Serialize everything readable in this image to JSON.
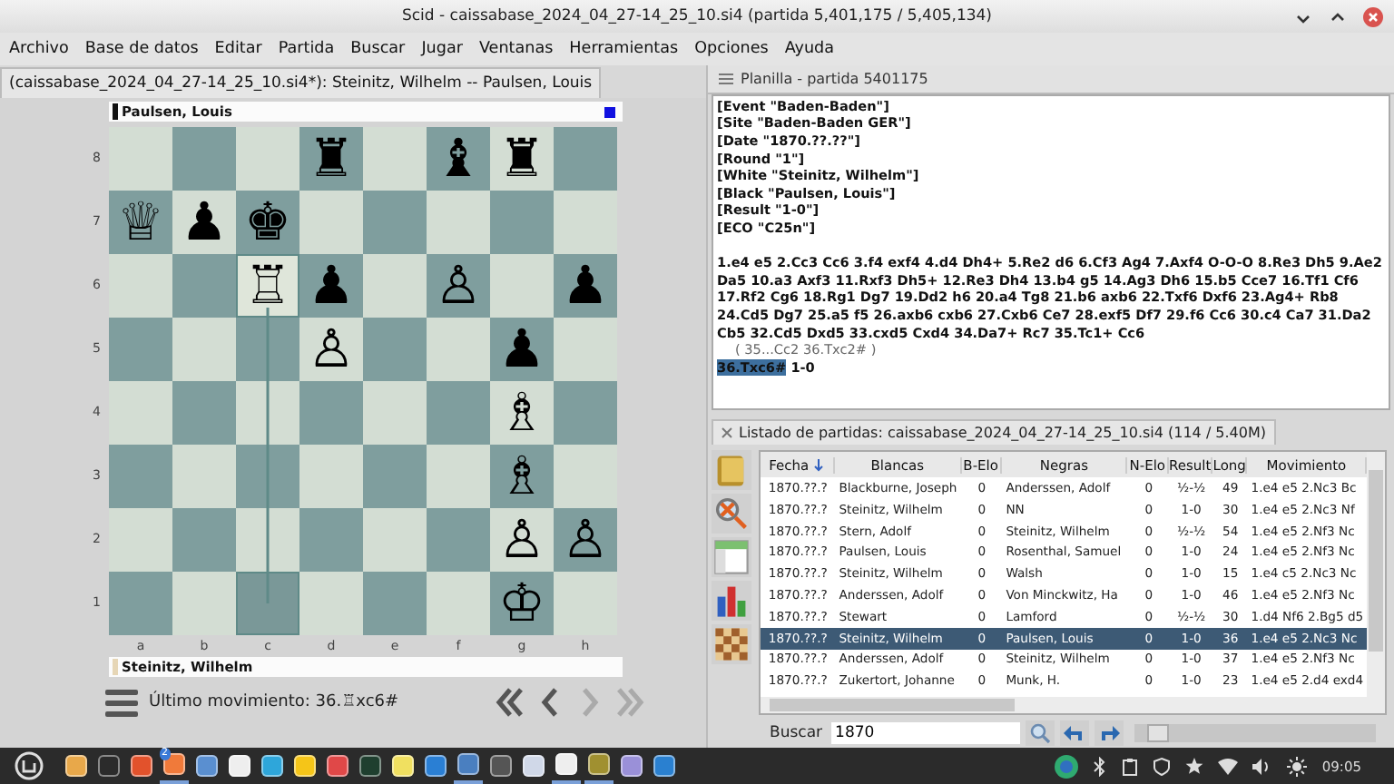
{
  "window": {
    "title": "Scid - caissabase_2024_04_27-14_25_10.si4 (partida 5,401,175 / 5,405,134)"
  },
  "menu": [
    "Archivo",
    "Base de datos",
    "Editar",
    "Partida",
    "Buscar",
    "Jugar",
    "Ventanas",
    "Herramientas",
    "Opciones",
    "Ayuda"
  ],
  "board_pane": {
    "tab": "(caissabase_2024_04_27-14_25_10.si4*): Steinitz, Wilhelm -- Paulsen, Louis",
    "top_player": "Paulsen, Louis",
    "bottom_player": "Steinitz, Wilhelm",
    "ranks": [
      "8",
      "7",
      "6",
      "5",
      "4",
      "3",
      "2",
      "1"
    ],
    "files": [
      "a",
      "b",
      "c",
      "d",
      "e",
      "f",
      "g",
      "h"
    ],
    "rows": [
      [
        {
          "highlighted": false
        },
        {
          "highlighted": false
        },
        {
          "highlighted": false
        },
        {
          "highlighted": false,
          "piece": "♜"
        },
        {
          "highlighted": false
        },
        {
          "highlighted": false,
          "piece": "♝"
        },
        {
          "highlighted": false,
          "piece": "♜"
        },
        {
          "highlighted": false
        }
      ],
      [
        {
          "highlighted": false,
          "piece": "♕"
        },
        {
          "highlighted": false,
          "piece": "♟"
        },
        {
          "highlighted": false,
          "piece": "♚"
        },
        {
          "highlighted": false
        },
        {
          "highlighted": false
        },
        {
          "highlighted": false
        },
        {
          "highlighted": false
        },
        {
          "highlighted": false
        }
      ],
      [
        {
          "highlighted": false
        },
        {
          "highlighted": false
        },
        {
          "highlighted": true,
          "piece": "♖"
        },
        {
          "highlighted": false,
          "piece": "♟"
        },
        {
          "highlighted": false
        },
        {
          "highlighted": false,
          "piece": "♙"
        },
        {
          "highlighted": false
        },
        {
          "highlighted": false,
          "piece": "♟"
        }
      ],
      [
        {
          "highlighted": false
        },
        {
          "highlighted": false
        },
        {
          "highlighted": false
        },
        {
          "highlighted": false,
          "piece": "♙"
        },
        {
          "highlighted": false
        },
        {
          "highlighted": false
        },
        {
          "highlighted": false,
          "piece": "♟"
        },
        {
          "highlighted": false
        }
      ],
      [
        {
          "highlighted": false
        },
        {
          "highlighted": false
        },
        {
          "highlighted": false
        },
        {
          "highlighted": false
        },
        {
          "highlighted": false
        },
        {
          "highlighted": false
        },
        {
          "highlighted": false,
          "piece": "♗"
        },
        {
          "highlighted": false
        }
      ],
      [
        {
          "highlighted": false
        },
        {
          "highlighted": false
        },
        {
          "highlighted": false
        },
        {
          "highlighted": false
        },
        {
          "highlighted": false
        },
        {
          "highlighted": false
        },
        {
          "highlighted": false,
          "piece": "♗"
        },
        {
          "highlighted": false
        }
      ],
      [
        {
          "highlighted": false
        },
        {
          "highlighted": false
        },
        {
          "highlighted": false
        },
        {
          "highlighted": false
        },
        {
          "highlighted": false
        },
        {
          "highlighted": false
        },
        {
          "highlighted": false,
          "piece": "♙"
        },
        {
          "highlighted": false,
          "piece": "♙"
        }
      ],
      [
        {
          "highlighted": false
        },
        {
          "highlighted": false
        },
        {
          "highlighted": true
        },
        {
          "highlighted": false
        },
        {
          "highlighted": false
        },
        {
          "highlighted": false
        },
        {
          "highlighted": false,
          "piece": "♔"
        },
        {
          "highlighted": false
        }
      ]
    ],
    "last_move": "Último movimiento: 36.♖xc6#",
    "nav": [
      {
        "kind": "first",
        "disabled": false
      },
      {
        "kind": "back",
        "disabled": false
      },
      {
        "kind": "forward",
        "disabled": true
      },
      {
        "kind": "last",
        "disabled": true
      }
    ]
  },
  "pgn": {
    "title": "Planilla - partida 5401175",
    "headers": [
      "[Event \"Baden-Baden\"]",
      "[Site \"Baden-Baden GER\"]",
      "[Date \"1870.??.??\"]",
      "[Round \"1\"]",
      "[White \"Steinitz, Wilhelm\"]",
      "[Black \"Paulsen, Louis\"]",
      "[Result \"1-0\"]",
      "[ECO \"C25n\"]"
    ],
    "moves": "1.e4 e5 2.Cc3 Cc6 3.f4 exf4 4.d4 Dh4+ 5.Re2 d6 6.Cf3 Ag4 7.Axf4 O-O-O 8.Re3 Dh5 9.Ae2 Da5 10.a3 Axf3 11.Rxf3 Dh5+ 12.Re3 Dh4 13.b4 g5 14.Ag3 Dh6 15.b5 Cce7 16.Tf1 Cf6 17.Rf2 Cg6 18.Rg1 Dg7 19.Dd2 h6 20.a4 Tg8 21.b6 axb6 22.Txf6 Dxf6 23.Ag4+ Rb8 24.Cd5 Dg7 25.a5 f5 26.axb6 cxb6 27.Cxb6 Ce7 28.exf5 Df7 29.f6 Cc6 30.c4 Ca7 31.Da2 Cb5 32.Cd5 Dxd5 33.cxd5 Cxd4 34.Da7+ Rc7 35.Tc1+ Cc6",
    "variation": "( 35...Cc2 36.Txc2# )",
    "current_move": "36.Txc6#",
    "result": "1-0"
  },
  "game_list": {
    "title": "Listado de partidas: caissabase_2024_04_27-14_25_10.si4 (114 / 5.40M)",
    "columns": [
      "Fecha",
      "Blancas",
      "B-Elo",
      "Negras",
      "N-Elo",
      "Result",
      "Long",
      "Movimiento"
    ],
    "rows": [
      {
        "cells": [
          "1870.??.?",
          "Blackburne, Joseph",
          "0",
          "Anderssen, Adolf",
          "0",
          "½-½",
          "49",
          "1.e4 e5 2.Nc3 Bc"
        ],
        "selected": false
      },
      {
        "cells": [
          "1870.??.?",
          "Steinitz, Wilhelm",
          "0",
          "NN",
          "0",
          "1-0",
          "30",
          "1.e4 e5 2.Nc3 Nf"
        ],
        "selected": false
      },
      {
        "cells": [
          "1870.??.?",
          "Stern, Adolf",
          "0",
          "Steinitz, Wilhelm",
          "0",
          "½-½",
          "54",
          "1.e4 e5 2.Nf3 Nc"
        ],
        "selected": false
      },
      {
        "cells": [
          "1870.??.?",
          "Paulsen, Louis",
          "0",
          "Rosenthal, Samuel",
          "0",
          "1-0",
          "24",
          "1.e4 e5 2.Nf3 Nc"
        ],
        "selected": false
      },
      {
        "cells": [
          "1870.??.?",
          "Steinitz, Wilhelm",
          "0",
          "Walsh",
          "0",
          "1-0",
          "15",
          "1.e4 c5 2.Nc3 Nc"
        ],
        "selected": false
      },
      {
        "cells": [
          "1870.??.?",
          "Anderssen, Adolf",
          "0",
          "Von Minckwitz, Ha",
          "0",
          "1-0",
          "46",
          "1.e4 e5 2.Nf3 Nc"
        ],
        "selected": false
      },
      {
        "cells": [
          "1870.??.?",
          "Stewart",
          "0",
          "Lamford",
          "0",
          "½-½",
          "30",
          "1.d4 Nf6 2.Bg5 d5"
        ],
        "selected": false
      },
      {
        "cells": [
          "1870.??.?",
          "Steinitz, Wilhelm",
          "0",
          "Paulsen, Louis",
          "0",
          "1-0",
          "36",
          "1.e4 e5 2.Nc3 Nc"
        ],
        "selected": true
      },
      {
        "cells": [
          "1870.??.?",
          "Anderssen, Adolf",
          "0",
          "Steinitz, Wilhelm",
          "0",
          "1-0",
          "37",
          "1.e4 e5 2.Nf3 Nc"
        ],
        "selected": false
      },
      {
        "cells": [
          "1870.??.?",
          "Zukertort, Johanne",
          "0",
          "Munk, H.",
          "0",
          "1-0",
          "23",
          "1.e4 e5 2.d4 exd4"
        ],
        "selected": false
      }
    ],
    "search_label": "Buscar",
    "search_value": "1870",
    "slider": {
      "level": 0.05
    }
  },
  "taskbar": {
    "apps": [
      {
        "color": "#e8a84a",
        "active": false
      },
      {
        "color": "#2b2b2b",
        "active": false
      },
      {
        "color": "#e2522c",
        "active": false
      },
      {
        "color": "#f07a3a",
        "active": true,
        "badge": "2"
      },
      {
        "color": "#5a8fd0",
        "active": false
      },
      {
        "color": "#eeeeee",
        "active": false
      },
      {
        "color": "#2ea6da",
        "active": false
      },
      {
        "color": "#f5c518",
        "active": false
      },
      {
        "color": "#e04848",
        "active": false
      },
      {
        "color": "#1f3f2f",
        "active": false
      },
      {
        "color": "#f0e060",
        "active": false
      },
      {
        "color": "#2a7fd4",
        "active": false
      },
      {
        "color": "#4a7fc0",
        "active": true
      },
      {
        "color": "#555555",
        "active": false
      },
      {
        "color": "#d0d8e8",
        "active": false
      },
      {
        "color": "#eeeeee",
        "active": true
      },
      {
        "color": "#a09030",
        "active": true
      },
      {
        "color": "#9a90d8",
        "active": false
      },
      {
        "color": "#2a80d0",
        "active": false
      }
    ],
    "clock": "09:05"
  }
}
